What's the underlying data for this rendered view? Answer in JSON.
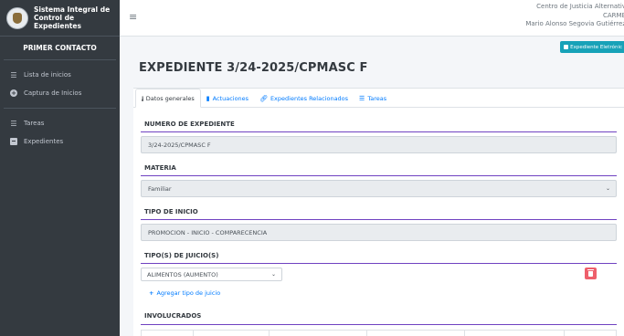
{
  "sidebar": {
    "brand": "Sistema Integral de Control de Expedientes",
    "section_title": "PRIMER CONTACTO",
    "items": [
      {
        "label": "Lista de inicios",
        "icon": "list-icon"
      },
      {
        "label": "Captura de Inicios",
        "icon": "plus-circle-icon"
      },
      {
        "label": "Tareas",
        "icon": "list-icon"
      },
      {
        "label": "Expedientes",
        "icon": "book-icon"
      }
    ]
  },
  "topbar": {
    "org": "Centro de Justicia Alternativ",
    "line2": "CARME",
    "user": "Mario Alonso Segovia Gutiérrez"
  },
  "actions": {
    "expediente_btn": "Expediente Eletrónic"
  },
  "page": {
    "title": "EXPEDIENTE 3/24-2025/CPMASC F"
  },
  "tabs": [
    {
      "label": "Datos generales",
      "active": true
    },
    {
      "label": "Actuaciones",
      "active": false
    },
    {
      "label": "Expedientes Relacionados",
      "active": false
    },
    {
      "label": "Tareas",
      "active": false
    }
  ],
  "form": {
    "numero_label": "NUMERO DE EXPEDIENTE",
    "numero_value": "3/24-2025/CPMASC F",
    "materia_label": "MATERIA",
    "materia_value": "Familiar",
    "tipo_inicio_label": "TIPO DE INICIO",
    "tipo_inicio_value": "PROMOCION - INICIO - COMPARECENCIA",
    "juicio_label": "TIPO(S) DE JUICIO(S)",
    "juicio_value": "ALIMENTOS (AUMENTO)",
    "add_juicio": "Agregar tipo de juicio",
    "involucrados_label": "INVOLUCRADOS"
  },
  "colors": {
    "sidebar_bg": "#343a40",
    "accent": "#6f42c1",
    "link": "#007bff",
    "info": "#17a2b8",
    "danger": "#ee5f6b"
  }
}
